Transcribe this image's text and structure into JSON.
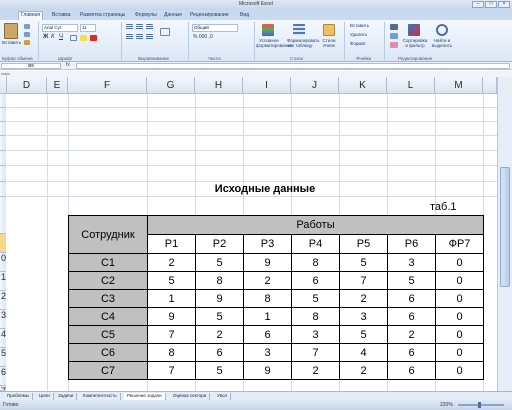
{
  "window": {
    "title": "Microsoft Excel"
  },
  "ribbon_tabs": [
    "Главная",
    "Вставка",
    "Разметка страницы",
    "Формулы",
    "Данные",
    "Рецензирование",
    "Вид"
  ],
  "ribbon": {
    "paste": "Вставить",
    "font_name": "Arial Cyr",
    "font_size": "11",
    "number_format": "Общий",
    "cond_format": "Условное форматирование",
    "format_table": "Форматировать как таблицу",
    "cell_styles": "Стили ячеек",
    "insert": "Вставить",
    "delete": "Удалить",
    "format": "Формат",
    "sort_filter": "Сортировка и фильтр",
    "find_select": "Найти и выделить",
    "groups": [
      "Буфер обмена",
      "Шрифт",
      "Выравнивание",
      "Число",
      "Стили",
      "Ячейки",
      "Редактирование"
    ]
  },
  "formula_bar": {
    "name_box": "B9",
    "fx": "fx",
    "value": ""
  },
  "path_text": "лмус",
  "columns": [
    "D",
    "E",
    "F",
    "G",
    "H",
    "I",
    "J",
    "K",
    "L",
    "M"
  ],
  "row_numbers": [
    "0",
    "1",
    "2",
    "3",
    "4",
    "5",
    "6",
    "7"
  ],
  "sheet": {
    "heading": "Исходные данные",
    "note": "таб.1",
    "employee_header": "Сотрудник",
    "work_header": "Работы",
    "work_cols": [
      "Р1",
      "Р2",
      "Р3",
      "Р4",
      "Р5",
      "Р6",
      "ФР7"
    ],
    "rows": [
      {
        "name": "С1",
        "values": [
          "2",
          "5",
          "9",
          "8",
          "5",
          "3",
          "0"
        ]
      },
      {
        "name": "С2",
        "values": [
          "5",
          "8",
          "2",
          "6",
          "7",
          "5",
          "0"
        ]
      },
      {
        "name": "С3",
        "values": [
          "1",
          "9",
          "8",
          "5",
          "2",
          "6",
          "0"
        ]
      },
      {
        "name": "С4",
        "values": [
          "9",
          "5",
          "1",
          "8",
          "3",
          "6",
          "0"
        ]
      },
      {
        "name": "С5",
        "values": [
          "7",
          "2",
          "6",
          "3",
          "5",
          "2",
          "0"
        ]
      },
      {
        "name": "С6",
        "values": [
          "8",
          "6",
          "3",
          "7",
          "4",
          "6",
          "0"
        ]
      },
      {
        "name": "С7",
        "values": [
          "7",
          "5",
          "9",
          "2",
          "2",
          "6",
          "0"
        ]
      }
    ]
  },
  "sheet_tabs": [
    "Проблемы",
    "Цели",
    "Задачи",
    "Компетентность",
    "Решение задачи",
    "Оценка сектора",
    "Увол"
  ],
  "active_sheet_tab": "Решение задачи",
  "status": {
    "text": "Готово",
    "zoom": "220%"
  }
}
